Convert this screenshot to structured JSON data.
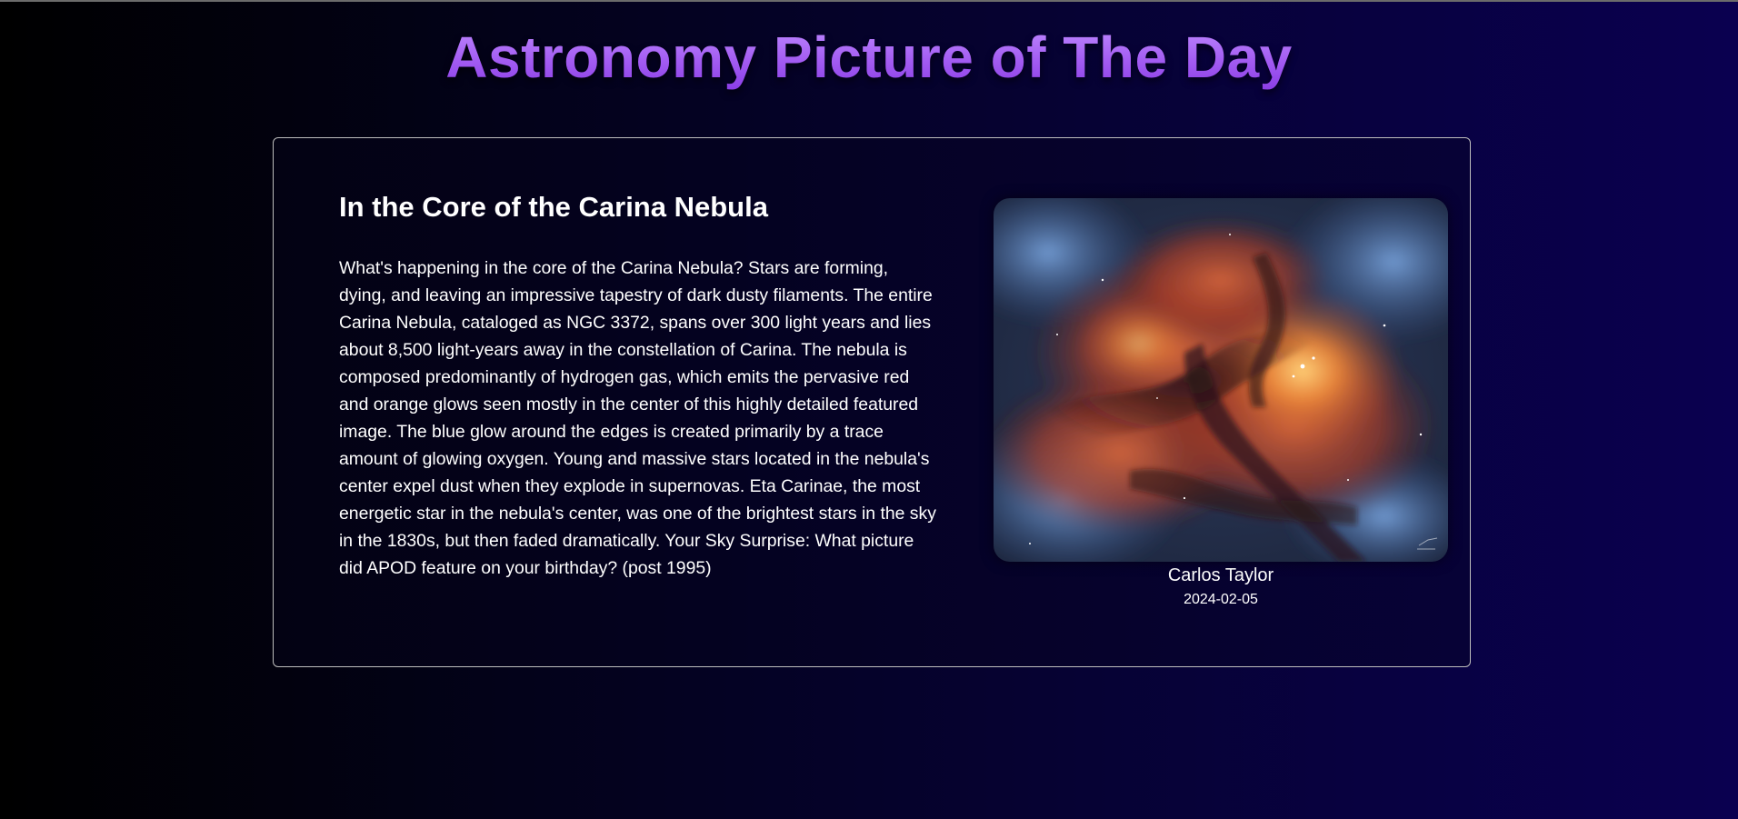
{
  "page": {
    "title": "Astronomy Picture of The Day"
  },
  "apod": {
    "title": "In the Core of the Carina Nebula",
    "explanation": "What's happening in the core of the Carina Nebula? Stars are forming, dying, and leaving an impressive tapestry of dark dusty filaments. The entire Carina Nebula, cataloged as NGC 3372, spans over 300 light years and lies about 8,500 light-years away in the constellation of Carina. The nebula is composed predominantly of hydrogen gas, which emits the pervasive red and orange glows seen mostly in the center of this highly detailed featured image. The blue glow around the edges is created primarily by a trace amount of glowing oxygen. Young and massive stars located in the nebula's center expel dust when they explode in supernovas. Eta Carinae, the most energetic star in the nebula's center, was one of the brightest stars in the sky in the 1830s, but then faded dramatically. Your Sky Surprise: What picture did APOD feature on your birthday? (post 1995)",
    "copyright": "Carlos Taylor",
    "date": "2024-02-05",
    "image_subject": "carina-nebula-photo"
  },
  "colors": {
    "title_accent": "#a855f7",
    "card_border": "#bdbdbd",
    "background_end": "#0a0050"
  }
}
